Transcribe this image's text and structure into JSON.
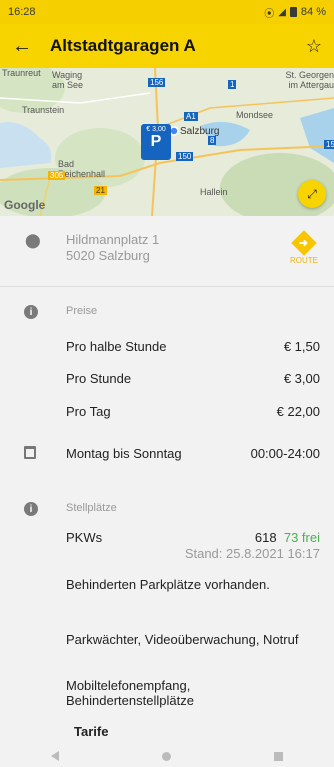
{
  "status_bar": {
    "time": "16:28",
    "battery": "84 %"
  },
  "app_bar": {
    "title": "Altstadtgaragen A"
  },
  "map": {
    "labels": [
      "Traunreut",
      "Waging am See",
      "St. Georgen im Attergau",
      "Traunstein",
      "Mondsee",
      "Bad Reichenhall",
      "Salzburg",
      "Hallein"
    ],
    "marker_price": "€ 3,00",
    "marker_symbol": "P",
    "road_badges": [
      "156",
      "1",
      "A1",
      "8",
      "150",
      "15",
      "305",
      "21"
    ],
    "logo": "Google"
  },
  "address": {
    "line1": "Hildmannplatz 1",
    "line2": "5020 Salzburg",
    "route_label": "ROUTE"
  },
  "prices": {
    "header": "Preise",
    "rows": [
      {
        "label": "Pro halbe Stunde",
        "value": "€ 1,50"
      },
      {
        "label": "Pro Stunde",
        "value": "€ 3,00"
      },
      {
        "label": "Pro Tag",
        "value": "€ 22,00"
      }
    ]
  },
  "hours": {
    "label": "Montag bis Sonntag",
    "value": "00:00-24:00"
  },
  "spaces": {
    "header": "Stellplätze",
    "type": "PKWs",
    "total": "618",
    "free": "73 frei",
    "stand": "Stand:  25.8.2021 16:17",
    "info": [
      "Behinderten Parkplätze vorhanden.",
      "Parkwächter, Videoüberwachung, Notruf",
      "Mobiltelefonempfang, Behindertenstellplätze"
    ],
    "tarife": "Tarife"
  }
}
